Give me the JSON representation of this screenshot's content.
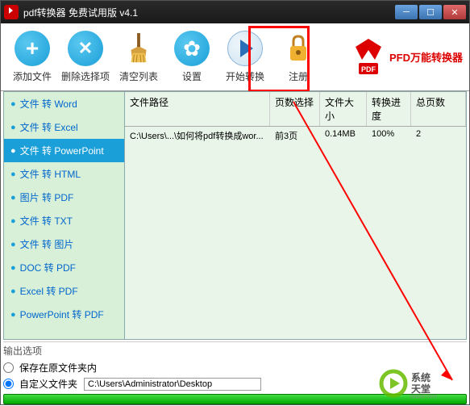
{
  "window": {
    "title": "pdf转换器 免费试用版 v4.1"
  },
  "toolbar": {
    "add": "添加文件",
    "delete": "删除选择项",
    "clear": "清空列表",
    "settings": "设置",
    "start": "开始转换",
    "register": "注册"
  },
  "brand": {
    "text": "PFD万能转换器",
    "badge": "PDF"
  },
  "sidebar": {
    "items": [
      {
        "label": "文件 转 Word"
      },
      {
        "label": "文件 转 Excel"
      },
      {
        "label": "文件 转 PowerPoint"
      },
      {
        "label": "文件 转 HTML"
      },
      {
        "label": "图片 转 PDF"
      },
      {
        "label": "文件 转 TXT"
      },
      {
        "label": "文件 转 图片"
      },
      {
        "label": "DOC 转 PDF"
      },
      {
        "label": "Excel 转 PDF"
      },
      {
        "label": "PowerPoint 转 PDF"
      }
    ],
    "active_index": 2
  },
  "filelist": {
    "headers": {
      "path": "文件路径",
      "pages": "页数选择",
      "size": "文件大小",
      "progress": "转换进度",
      "total": "总页数"
    },
    "rows": [
      {
        "path": "C:\\Users\\...\\如何将pdf转换成wor...",
        "pages": "前3页",
        "size": "0.14MB",
        "progress": "100%",
        "total": "2"
      }
    ]
  },
  "output": {
    "title": "输出选项",
    "save_original": "保存在原文件夹内",
    "custom_folder": "自定义文件夹",
    "custom_path": "C:\\Users\\Administrator\\Desktop"
  }
}
